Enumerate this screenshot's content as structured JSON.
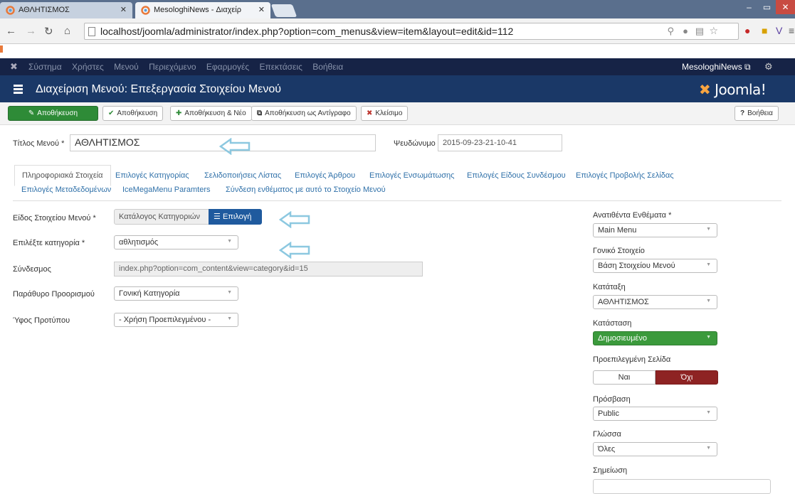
{
  "browser": {
    "tabs": [
      {
        "label": "ΑΘΛΗΤΙΣΜΟΣ"
      },
      {
        "label": "MesologhiNews - Διαχείρ"
      }
    ],
    "url": "localhost/joomla/administrator/index.php?option=com_menus&view=item&layout=edit&id=112"
  },
  "topnav": {
    "items": [
      "Σύστημα",
      "Χρήστες",
      "Μενού",
      "Περιεχόμενο",
      "Εφαρμογές",
      "Επεκτάσεις",
      "Βοήθεια"
    ],
    "site": "MesologhiNews"
  },
  "header": {
    "title": "Διαχείριση Μενού: Επεξεργασία Στοιχείου Μενού",
    "logo": "Joomla!"
  },
  "toolbar": {
    "save": "Αποθήκευση",
    "save_close": "Αποθήκευση",
    "save_new": "Αποθήκευση & Νέο",
    "save_copy": "Αποθήκευση ως Αντίγραφο",
    "close": "Κλείσιμο",
    "help": "Βοήθεια"
  },
  "form": {
    "title_label": "Τίτλος Μενού *",
    "title_value": "ΑΘΛΗΤΙΣΜΟΣ",
    "alias_label": "Ψευδώνυμο",
    "alias_value": "2015-09-23-21-10-41"
  },
  "tabs": [
    "Πληροφοριακά Στοιχεία",
    "Επιλογές Κατηγορίας",
    "Σελιδοποιήσεις Λίστας",
    "Επιλογές Άρθρου",
    "Επιλογές Ενσωμάτωσης",
    "Επιλογές Είδους Συνδέσμου",
    "Επιλογές Προβολής Σελίδας",
    "Επιλογές Μεταδεδομένων",
    "IceMegaMenu Paramters",
    "Σύνδεση ενθέματος με αυτό το Στοιχείο Μενού"
  ],
  "details": {
    "type_label": "Είδος Στοιχείου Μενού *",
    "type_value": "Κατάλογος Κατηγοριών",
    "type_button": "Επιλογή",
    "category_label": "Επιλέξτε κατηγορία *",
    "category_value": "αθλητισμός",
    "link_label": "Σύνδεσμος",
    "link_value": "index.php?option=com_content&view=category&id=15",
    "target_label": "Παράθυρο Προορισμού",
    "target_value": "Γονική Κατηγορία",
    "style_label": "Ύφος Προτύπου",
    "style_value": "- Χρήση Προεπιλεγμένου -"
  },
  "sidebar": {
    "menu_label": "Ανατιθέντα Ενθέματα *",
    "menu_value": "Main Menu",
    "parent_label": "Γονικό Στοιχείο",
    "parent_value": "Βάση Στοιχείου Μενού",
    "order_label": "Κατάταξη",
    "order_value": "ΑΘΛΗΤΙΣΜΟΣ",
    "status_label": "Κατάσταση",
    "status_value": "Δημοσιευμένο",
    "home_label": "Προεπιλεγμένη Σελίδα",
    "home_yes": "Ναι",
    "home_no": "Όχι",
    "access_label": "Πρόσβαση",
    "access_value": "Public",
    "language_label": "Γλώσσα",
    "language_value": "Όλες",
    "note_label": "Σημείωση"
  },
  "colors": {
    "nav_bg": "#162346",
    "header_bg": "#1a3867",
    "save_green": "#2e8b37",
    "status_green": "#3b9a3c",
    "no_red": "#8e2323",
    "arrow": "#8cc8e0"
  }
}
